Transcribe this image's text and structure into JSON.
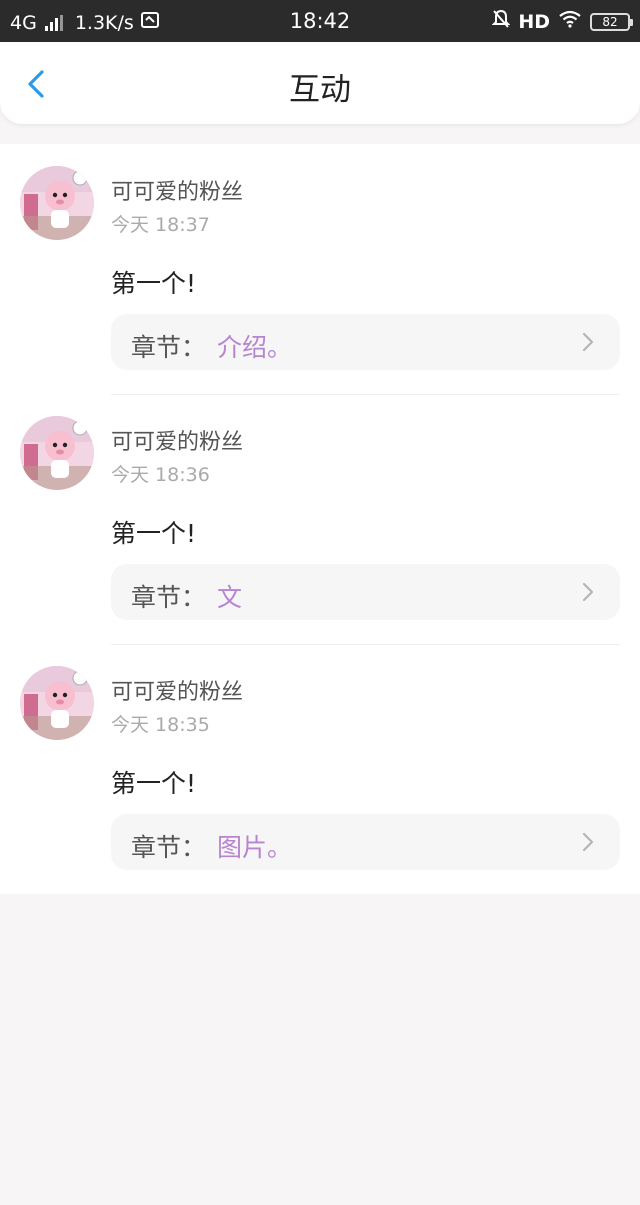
{
  "status_bar": {
    "network": "4G",
    "speed": "1.3K/s",
    "time": "18:42",
    "hd": "HD",
    "battery": "82"
  },
  "nav": {
    "title": "互动",
    "back_icon": "chevron-left-icon"
  },
  "colors": {
    "accent": "#2a9be8",
    "chapter_link": "#b784cf",
    "background": "#f7f5f6"
  },
  "comments": [
    {
      "username": "可可爱的粉丝",
      "time": "今天 18:37",
      "content": "第一个!",
      "chapter_label": "章节：",
      "chapter_name": "介绍。"
    },
    {
      "username": "可可爱的粉丝",
      "time": "今天 18:36",
      "content": "第一个!",
      "chapter_label": "章节：",
      "chapter_name": "文"
    },
    {
      "username": "可可爱的粉丝",
      "time": "今天 18:35",
      "content": "第一个!",
      "chapter_label": "章节：",
      "chapter_name": "图片。"
    }
  ]
}
